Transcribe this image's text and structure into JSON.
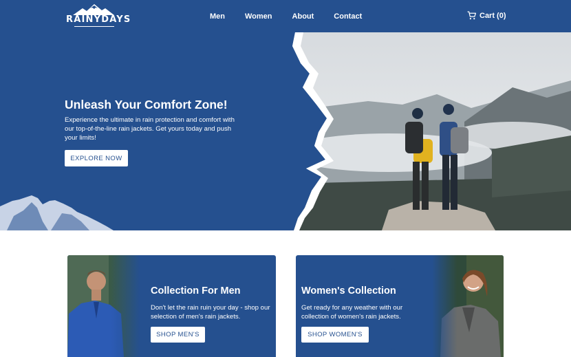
{
  "brand": {
    "name": "RAINYDAYS"
  },
  "nav": {
    "links": [
      {
        "label": "Men"
      },
      {
        "label": "Women"
      },
      {
        "label": "About"
      },
      {
        "label": "Contact"
      }
    ],
    "cart_label": "Cart (0)"
  },
  "hero": {
    "title": "Unleash Your Comfort Zone!",
    "text": "Experience the ultimate in rain protection and comfort with our top-of-the-line rain jackets. Get yours today and push your limits!",
    "button": "EXPLORE NOW"
  },
  "collections": [
    {
      "title": "Collection For Men",
      "text": "Don't let the rain ruin your day - shop our selection of men's rain jackets.",
      "button": "SHOP MEN'S"
    },
    {
      "title": "Women's Collection",
      "text": "Get ready for any weather with our collection of women's rain jackets.",
      "button": "SHOP WOMEN'S"
    }
  ],
  "colors": {
    "brand_blue": "#25508f",
    "white": "#ffffff"
  },
  "icons": {
    "cart": "cart-icon",
    "logo": "mountain-logo-icon"
  }
}
